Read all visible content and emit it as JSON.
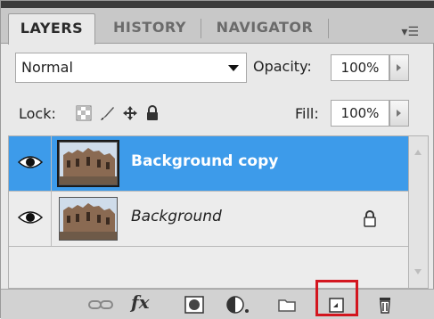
{
  "tabs": [
    {
      "label": "LAYERS",
      "active": true
    },
    {
      "label": "HISTORY",
      "active": false
    },
    {
      "label": "NAVIGATOR",
      "active": false
    }
  ],
  "panel_menu_icon": "panel-menu-icon",
  "blend_mode": {
    "value": "Normal"
  },
  "opacity": {
    "label": "Opacity:",
    "value": "100%"
  },
  "lock": {
    "label": "Lock:",
    "icons": [
      "lock-transparent-pixels-icon",
      "lock-image-pixels-icon",
      "lock-position-icon",
      "lock-all-icon"
    ]
  },
  "fill": {
    "label": "Fill:",
    "value": "100%"
  },
  "layers": [
    {
      "name": "Background copy",
      "selected": true,
      "visible": true
    },
    {
      "name": "Background",
      "selected": false,
      "visible": true,
      "locked": true
    }
  ],
  "bottom_icons": [
    "link-layers-icon",
    "fx-icon",
    "add-mask-icon",
    "adjustment-layer-icon",
    "new-group-icon",
    "new-layer-icon",
    "trash-icon"
  ],
  "bottom_labels": {
    "fx": "fx"
  },
  "colors": {
    "selection": "#3d9bea",
    "highlight": "#d3161f"
  }
}
